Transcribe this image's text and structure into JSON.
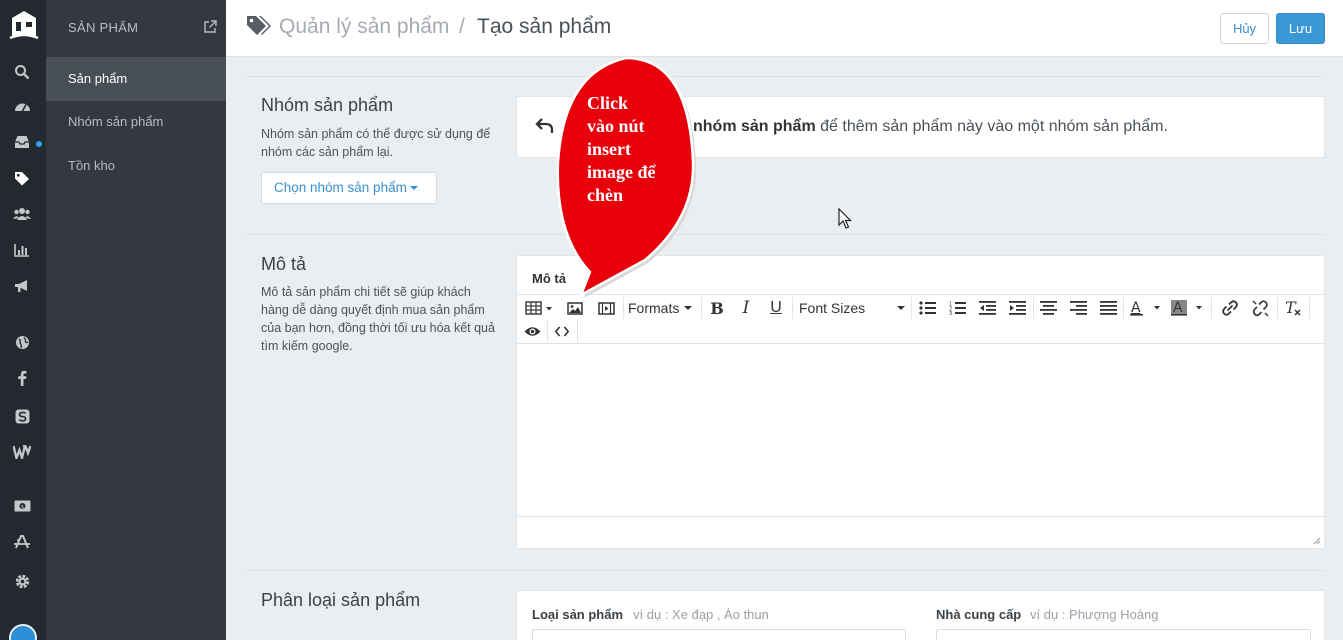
{
  "sidebar": {
    "header": "SẢN PHẨM",
    "items": [
      {
        "label": "Sản phẩm",
        "active": true
      },
      {
        "label": "Nhóm sản phẩm",
        "active": false
      },
      {
        "label": "Tồn kho",
        "active": false
      }
    ]
  },
  "header": {
    "breadcrumb_parent": "Quản lý sản phẩm",
    "separator": "/",
    "breadcrumb_current": "Tạo sản phẩm",
    "cancel_label": "Hủy",
    "save_label": "Lưu"
  },
  "group_section": {
    "title": "Nhóm sản phẩm",
    "description": "Nhóm sản phẩm có thể được sử dụng để nhóm các sản phẩm lại.",
    "button_label": "Chọn nhóm sản phẩm",
    "hint_bold": "nhóm sản phẩm",
    "hint_rest": " để thêm sản phẩm này vào một nhóm sản phẩm."
  },
  "description_section": {
    "title": "Mô tả",
    "description": "Mô tả sản phẩm chi tiết sẽ giúp khách hàng dễ dàng quyết định mua sản phẩm của bạn hơn, đồng thời tối ưu hóa kết quả tìm kiếm google.",
    "editor_label": "Mô tả",
    "formats_label": "Formats",
    "font_sizes_label": "Font Sizes"
  },
  "classification_section": {
    "title": "Phân loại sản phẩm",
    "type_label": "Loại sản phẩm",
    "type_placeholder": "ví dụ : Xe đạp , Áo thun",
    "vendor_label": "Nhà cung cấp",
    "vendor_placeholder": "ví dụ : Phượng Hoàng"
  },
  "callout": {
    "lines": [
      "Click",
      "vào nút",
      "insert",
      "image để",
      "chèn"
    ],
    "color": "#e8000b"
  },
  "colors": {
    "accent": "#3a98d7",
    "rail": "#24292f",
    "sidebar": "#34393f"
  }
}
